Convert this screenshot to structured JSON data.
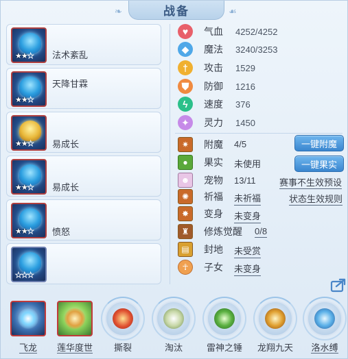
{
  "title": "战备",
  "cards": [
    {
      "name": "法术紊乱",
      "stars": 2,
      "max_stars": 3,
      "frame": "red",
      "art": "blue"
    },
    {
      "name": "天降甘霖",
      "stars": 2,
      "max_stars": 3,
      "frame": "red",
      "art": "blue"
    },
    {
      "name": "易成长",
      "stars": 2,
      "max_stars": 3,
      "frame": "red",
      "art": "gold"
    },
    {
      "name": "易成长",
      "stars": 2,
      "max_stars": 3,
      "frame": "red",
      "art": "blue"
    },
    {
      "name": "愤怒",
      "stars": 2,
      "max_stars": 3,
      "frame": "red",
      "art": "blue"
    },
    {
      "name": "",
      "stars": 0,
      "max_stars": 3,
      "frame": "blue",
      "art": "blue"
    }
  ],
  "stats": [
    {
      "label": "气血",
      "value": "4252/4252",
      "icon": "heart-icon",
      "color": "#e8606a"
    },
    {
      "label": "魔法",
      "value": "3240/3253",
      "icon": "diamond-icon",
      "color": "#4fa8e8"
    },
    {
      "label": "攻击",
      "value": "1529",
      "icon": "sword-icon",
      "color": "#f0b030"
    },
    {
      "label": "防御",
      "value": "1216",
      "icon": "shield-icon",
      "color": "#f08a40"
    },
    {
      "label": "速度",
      "value": "376",
      "icon": "lightning-icon",
      "color": "#2cc08a"
    },
    {
      "label": "灵力",
      "value": "1450",
      "icon": "spirit-icon",
      "color": "#c68ae8"
    }
  ],
  "attrs": [
    {
      "label": "附魔",
      "value": "4/5",
      "icon": "enchant-icon",
      "underline": false
    },
    {
      "label": "果实",
      "value": "未使用",
      "icon": "fruit-icon",
      "underline": false
    },
    {
      "label": "宠物",
      "value": "13/11",
      "icon": "pet-icon",
      "underline": false
    },
    {
      "label": "祈福",
      "value": "未祈福",
      "icon": "blessing-icon",
      "underline": true
    },
    {
      "label": "变身",
      "value": "未变身",
      "icon": "transform-icon",
      "underline": true
    },
    {
      "label": "修炼觉醒",
      "value": "0/8",
      "icon": "cultivation-icon",
      "underline": true
    },
    {
      "label": "封地",
      "value": "未受赏",
      "icon": "fief-icon",
      "underline": true
    },
    {
      "label": "子女",
      "value": "未变身",
      "icon": "child-icon",
      "underline": true
    }
  ],
  "buttons": {
    "enchant": "一键附魔",
    "fruit": "一键果实"
  },
  "links": {
    "preset": "赛事不生效预设",
    "rules": "状态生效规则"
  },
  "skills": [
    {
      "label": "飞龙",
      "style": "square",
      "underline": true
    },
    {
      "label": "莲华度世",
      "style": "square-green",
      "underline": true
    },
    {
      "label": "撕裂",
      "style": "round",
      "underline": false
    },
    {
      "label": "淘汰",
      "style": "round",
      "underline": false
    },
    {
      "label": "雷神之锤",
      "style": "round",
      "underline": false
    },
    {
      "label": "龙翔九天",
      "style": "round",
      "underline": false
    },
    {
      "label": "洛水缚",
      "style": "round",
      "underline": true
    }
  ]
}
